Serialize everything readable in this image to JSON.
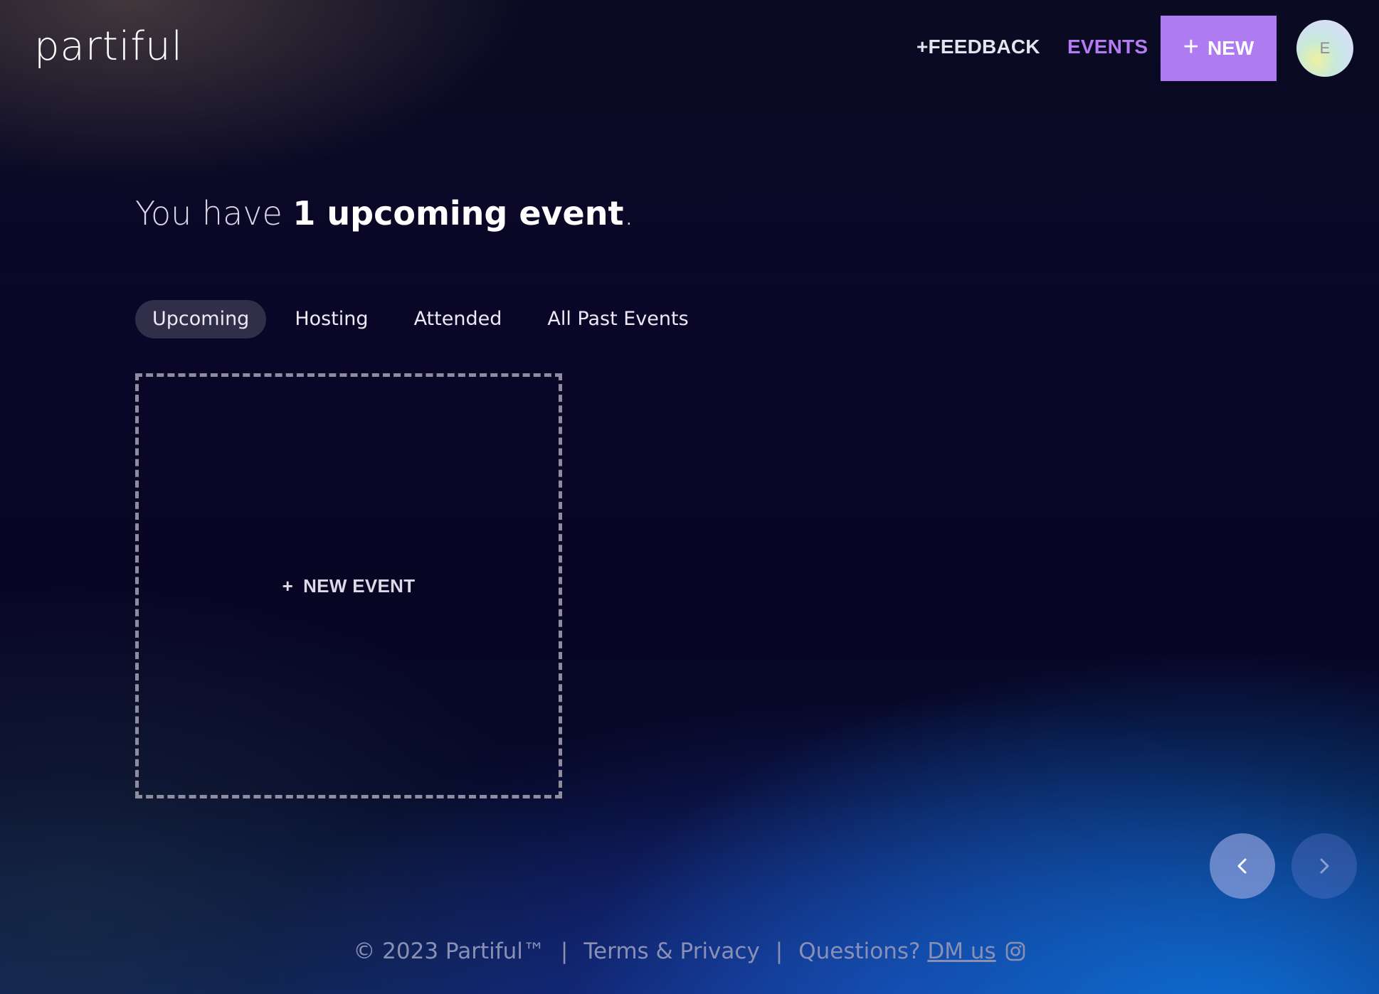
{
  "header": {
    "logo_text": "partiful",
    "feedback_label": "+FEEDBACK",
    "events_label": "EVENTS",
    "new_button_label": "NEW",
    "avatar_initial": "E"
  },
  "main": {
    "headline_prefix": "You have ",
    "headline_count_text": "1 upcoming event",
    "headline_suffix": ".",
    "tabs": [
      {
        "label": "Upcoming",
        "active": true
      },
      {
        "label": "Hosting",
        "active": false
      },
      {
        "label": "Attended",
        "active": false
      },
      {
        "label": "All Past Events",
        "active": false
      }
    ],
    "new_event_card_label": "NEW EVENT"
  },
  "carousel": {
    "prev_icon": "chevron-left-icon",
    "next_icon": "chevron-right-icon"
  },
  "footer": {
    "copyright": "© 2023 Partiful™",
    "separator": "|",
    "terms_label": "Terms & Privacy",
    "questions_label": "Questions?",
    "dm_label": "DM us",
    "dm_icon": "instagram-icon"
  },
  "colors": {
    "accent": "#ae7cf0",
    "events_link": "#b47cf2",
    "footer_text": "#8a90b4"
  }
}
